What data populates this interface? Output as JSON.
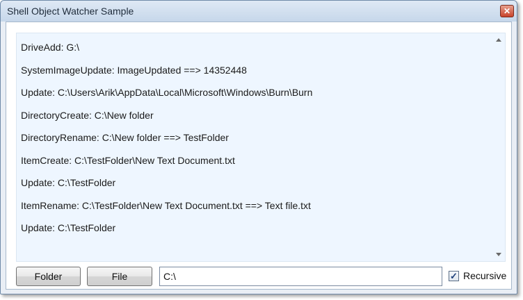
{
  "window": {
    "title": "Shell Object Watcher Sample",
    "close_symbol": "✕"
  },
  "events": [
    "DriveAdd: G:\\",
    "SystemImageUpdate: ImageUpdated ==> 14352448",
    "Update: C:\\Users\\Arik\\AppData\\Local\\Microsoft\\Windows\\Burn\\Burn",
    "DirectoryCreate: C:\\New folder",
    "DirectoryRename: C:\\New folder ==> TestFolder",
    "ItemCreate: C:\\TestFolder\\New Text Document.txt",
    "Update: C:\\TestFolder",
    "ItemRename: C:\\TestFolder\\New Text Document.txt ==> Text file.txt",
    "Update: C:\\TestFolder"
  ],
  "toolbar": {
    "folder_label": "Folder",
    "file_label": "File",
    "path_value": "C:\\",
    "recursive_label": "Recursive",
    "recursive_checked": true,
    "check_symbol": "✓"
  }
}
